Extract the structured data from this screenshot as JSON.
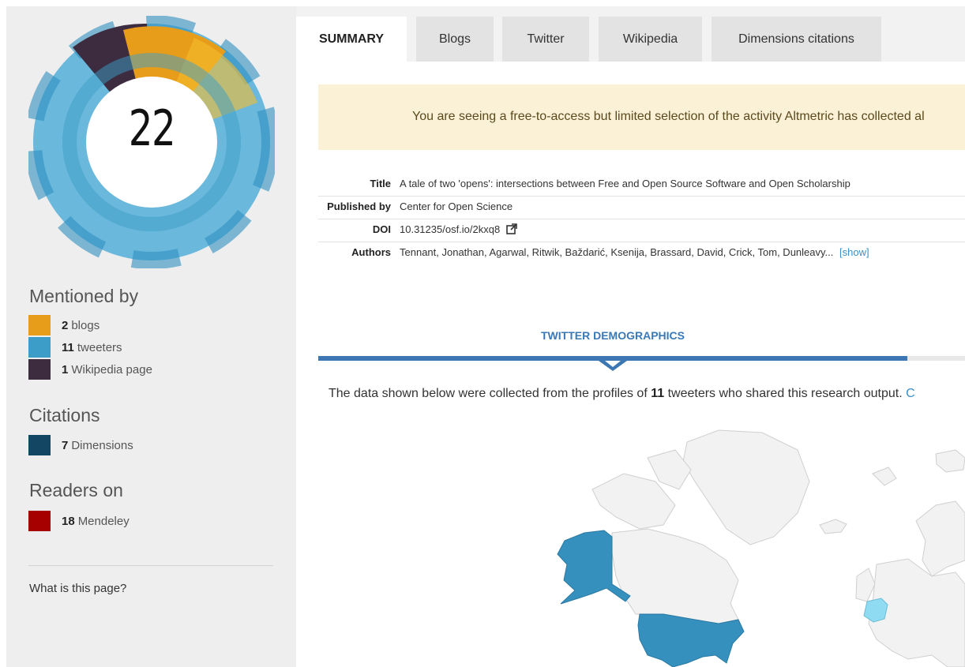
{
  "score": "22",
  "colors": {
    "blogs": "#e89d1a",
    "tweeters": "#3b9dc8",
    "wikipedia": "#3d2c40",
    "dimensions": "#124663",
    "mendeley": "#a70000",
    "accent": "#3d77b3"
  },
  "sidebar": {
    "mentioned_title": "Mentioned by",
    "mentions": [
      {
        "count": "2",
        "label": "blogs"
      },
      {
        "count": "11",
        "label": "tweeters"
      },
      {
        "count": "1",
        "label": "Wikipedia page"
      }
    ],
    "citations_title": "Citations",
    "citations": [
      {
        "count": "7",
        "label": "Dimensions"
      }
    ],
    "readers_title": "Readers on",
    "readers": [
      {
        "count": "18",
        "label": "Mendeley"
      }
    ],
    "what_link": "What is this page?"
  },
  "tabs": [
    "SUMMARY",
    "Blogs",
    "Twitter",
    "Wikipedia",
    "Dimensions citations"
  ],
  "notice": "You are seeing a free-to-access but limited selection of the activity Altmetric has collected al",
  "details": {
    "title_label": "Title",
    "title_value": "A tale of two 'opens': intersections between Free and Open Source Software and Open Scholarship",
    "published_label": "Published by",
    "published_value": "Center for Open Science",
    "doi_label": "DOI",
    "doi_value": "10.31235/osf.io/2kxq8",
    "authors_label": "Authors",
    "authors_value": "Tennant, Jonathan, Agarwal, Ritwik, Baždarić, Ksenija, Brassard, David, Crick, Tom, Dunleavy...",
    "show_link": "[show]"
  },
  "twitter": {
    "heading": "TWITTER DEMOGRAPHICS",
    "desc_before": "The data shown below were collected from the profiles of ",
    "desc_count": "11",
    "desc_after": " tweeters who shared this research output. ",
    "desc_link": "C"
  }
}
